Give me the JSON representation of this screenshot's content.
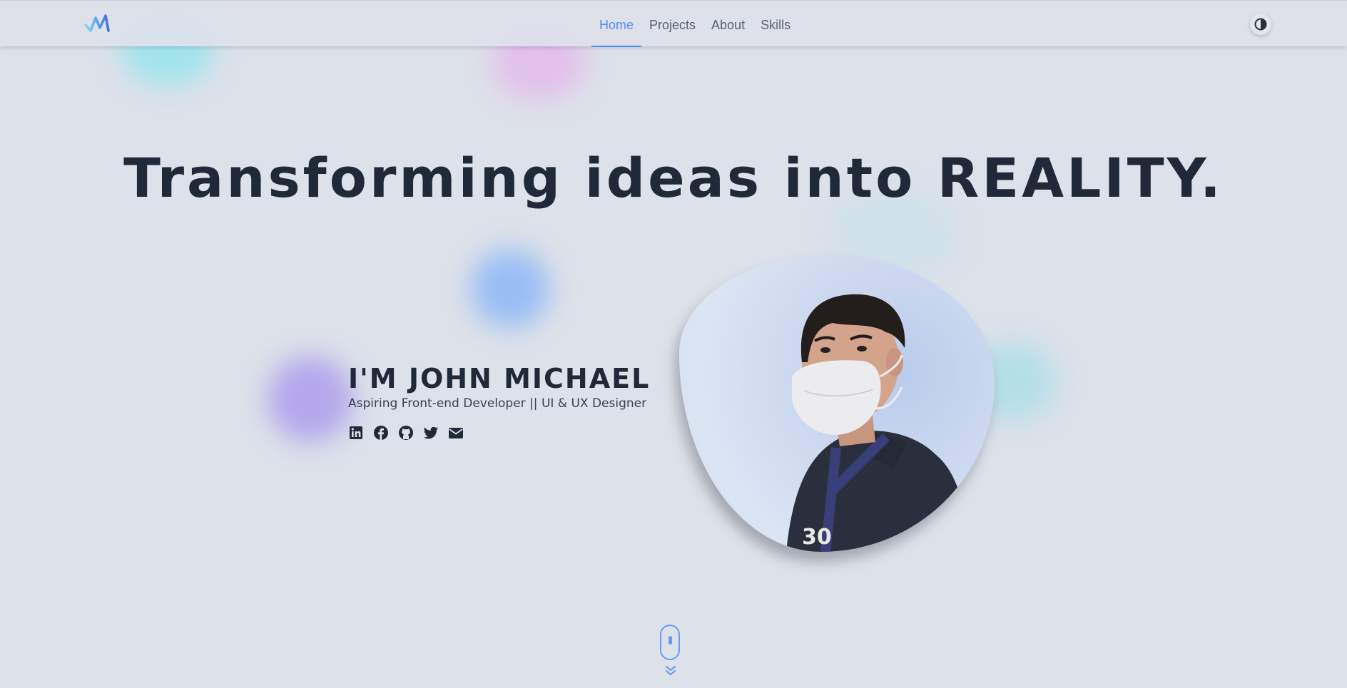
{
  "nav": {
    "logo_alt": "JM logo",
    "links": [
      {
        "label": "Home",
        "active": true
      },
      {
        "label": "Projects",
        "active": false
      },
      {
        "label": "About",
        "active": false
      },
      {
        "label": "Skills",
        "active": false
      }
    ],
    "theme_toggle_icon": "contrast-icon"
  },
  "hero": {
    "title": "Transforming ideas into REALITY.",
    "name": "I'M JOHN MICHAEL",
    "subtitle": "Aspiring Front-end Developer || UI & UX Designer",
    "socials": [
      {
        "icon": "linkedin-icon"
      },
      {
        "icon": "facebook-icon"
      },
      {
        "icon": "github-icon"
      },
      {
        "icon": "twitter-icon"
      },
      {
        "icon": "email-icon"
      }
    ],
    "photo_icon": "profile-photo"
  },
  "colors": {
    "accent": "#4f8ef5",
    "text": "#1f2937",
    "background": "#dde1e9"
  },
  "scroll_indicator": {
    "icon": "mouse-scroll-icon"
  }
}
